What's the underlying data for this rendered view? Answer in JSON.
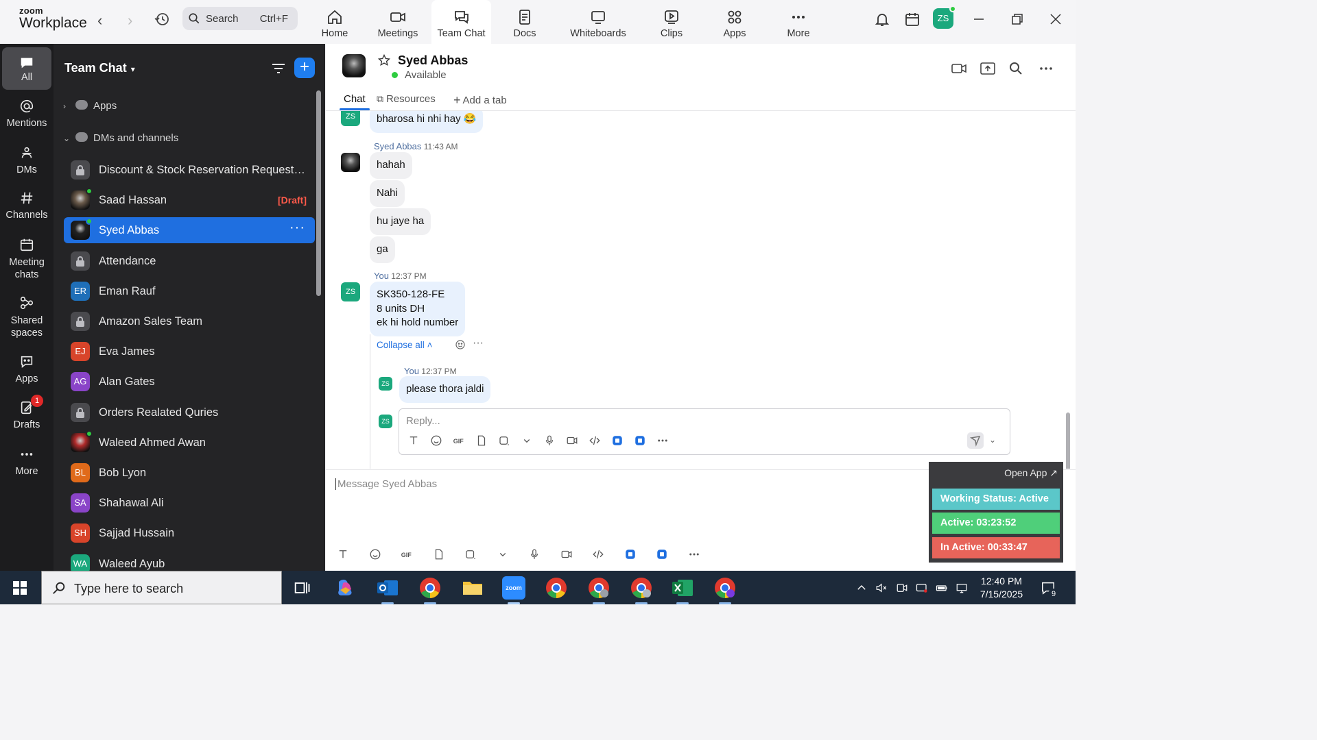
{
  "brand": {
    "line1": "zoom",
    "line2": "Workplace"
  },
  "search": {
    "label": "Search",
    "shortcut": "Ctrl+F"
  },
  "nav_tabs": [
    {
      "label": "Home",
      "icon": "home-icon"
    },
    {
      "label": "Meetings",
      "icon": "video-camera-icon"
    },
    {
      "label": "Team Chat",
      "icon": "chat-icon",
      "active": true
    },
    {
      "label": "Docs",
      "icon": "document-icon"
    },
    {
      "label": "Whiteboards",
      "icon": "whiteboard-icon"
    },
    {
      "label": "Clips",
      "icon": "clips-icon"
    },
    {
      "label": "Apps",
      "icon": "apps-icon"
    },
    {
      "label": "More",
      "icon": "more-dots-icon"
    }
  ],
  "user": {
    "initials": "ZS",
    "status": "online"
  },
  "rail": [
    {
      "label": "All",
      "icon": "chat-bubble-icon",
      "active": true
    },
    {
      "label": "Mentions",
      "icon": "at-sign-icon"
    },
    {
      "label": "DMs",
      "icon": "people-icon"
    },
    {
      "label": "Channels",
      "icon": "hash-icon"
    },
    {
      "label": "Meeting chats",
      "icon": "calendar-icon"
    },
    {
      "label": "Shared spaces",
      "icon": "shared-spaces-icon"
    },
    {
      "label": "Apps",
      "icon": "apps-chat-icon"
    },
    {
      "label": "Drafts",
      "icon": "drafts-icon",
      "badge": "1"
    },
    {
      "label": "More",
      "icon": "more-dots-icon"
    }
  ],
  "chatlist": {
    "title": "Team Chat",
    "sections": {
      "apps": "Apps",
      "dms": "DMs and channels"
    },
    "items": [
      {
        "name": "Discount & Stock Reservation Requests O...",
        "type": "lock"
      },
      {
        "name": "Saad Hassan",
        "type": "photo",
        "photo": "#6a5a4a",
        "status": "#2ecc40",
        "draft": "[Draft]"
      },
      {
        "name": "Syed Abbas",
        "type": "photo",
        "photo": "#222",
        "status": "#2ecc40",
        "active": true
      },
      {
        "name": "Attendance",
        "type": "lock"
      },
      {
        "name": "Eman Rauf",
        "type": "initials",
        "initials": "ER",
        "color": "#1f6fb8",
        "status": "#2ecc40"
      },
      {
        "name": "Amazon Sales Team",
        "type": "lock"
      },
      {
        "name": "Eva James",
        "type": "initials",
        "initials": "EJ",
        "color": "#d8442a",
        "status": "#9a9a9e"
      },
      {
        "name": "Alan Gates",
        "type": "initials",
        "initials": "AG",
        "color": "#8a44c8",
        "status": "#2ecc40"
      },
      {
        "name": "Orders Realated Quries",
        "type": "lock"
      },
      {
        "name": "Waleed Ahmed Awan",
        "type": "photo",
        "photo": "#b02a2a",
        "status": "#2ecc40"
      },
      {
        "name": "Bob Lyon",
        "type": "initials",
        "initials": "BL",
        "color": "#e06a1a",
        "status": "#ff5a2a"
      },
      {
        "name": "Shahawal Ali",
        "type": "initials",
        "initials": "SA",
        "color": "#8a44c8",
        "status": ""
      },
      {
        "name": "Sajjad Hussain",
        "type": "initials",
        "initials": "SH",
        "color": "#d8442a",
        "status": "#ff5a2a"
      },
      {
        "name": "Waleed Ayub",
        "type": "initials",
        "initials": "WA",
        "color": "#1ba87d",
        "status": "#ff5a2a"
      }
    ]
  },
  "chat": {
    "peer_name": "Syed Abbas",
    "peer_status": "Available",
    "tabs": [
      "Chat",
      "Resources",
      "Add a tab"
    ]
  },
  "messages": [
    {
      "avatar": "ZS",
      "text": "bharosa hi nhi hay 😂"
    },
    {
      "sender": "Syed Abbas",
      "time": "11:43 AM",
      "bubbles": [
        "hahah",
        "Nahi",
        "hu jaye ha",
        "ga"
      ]
    },
    {
      "sender": "You",
      "time": "12:37 PM",
      "avatar": "ZS",
      "text": "SK350-128-FE\n8 units DH\nek hi hold number"
    }
  ],
  "thread": {
    "collapse_label": "Collapse all",
    "reply_sender": "You",
    "reply_time": "12:37 PM",
    "reply_avatar": "ZS",
    "reply_text": "please thora jaldi",
    "reply_placeholder": "Reply..."
  },
  "composer": {
    "placeholder": "Message Syed Abbas"
  },
  "widget": {
    "open_app": "Open App ↗",
    "working_status": "Working Status: Active",
    "active": "Active: 03:23:52",
    "inactive": "In Active: 00:33:47",
    "colors": {
      "working": "#5bc7c9",
      "active": "#4fcf7a",
      "inactive": "#e7645a"
    }
  },
  "taskbar": {
    "search_placeholder": "Type here to search",
    "time": "12:40 PM",
    "date": "7/15/2025",
    "notification_count": "9",
    "apps": [
      "task-view-icon",
      "copilot-icon",
      "outlook-icon",
      "chrome-icon",
      "file-explorer-icon",
      "zoom-icon",
      "chrome-icon",
      "chrome-icon",
      "chrome-icon",
      "excel-icon",
      "chrome-icon"
    ]
  }
}
